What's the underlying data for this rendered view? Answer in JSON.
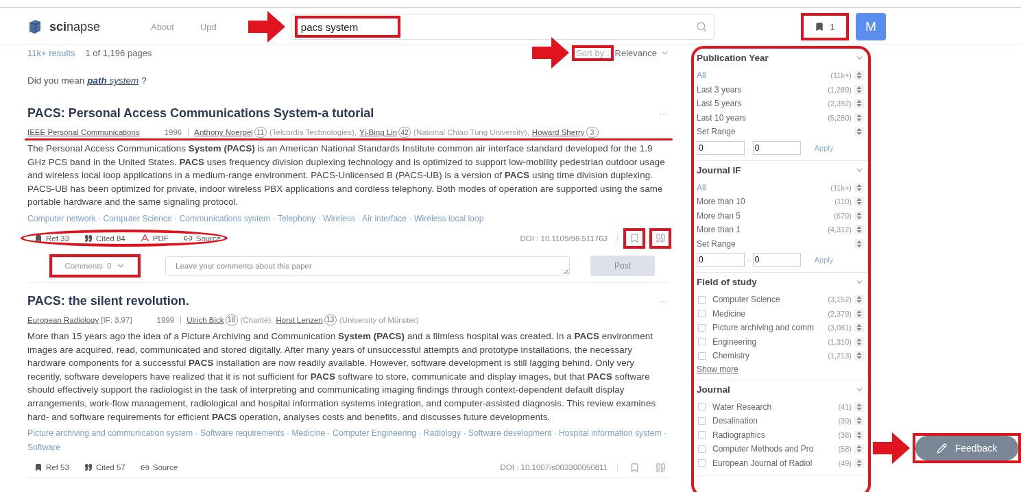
{
  "header": {
    "logo": "**sci**napse",
    "nav": [
      "About",
      "Upd"
    ],
    "search": {
      "value": "pacs system",
      "highlighted": true,
      "arrow": true
    },
    "bookmarks": {
      "count": "1",
      "highlighted": true
    },
    "avatar": "M"
  },
  "results": {
    "count": "11k+ results",
    "pages": "1 of 1,196 pages",
    "sort": {
      "label": "Sort by :",
      "value": "Relevance",
      "highlighted": true,
      "arrow": true
    }
  },
  "suggestion": {
    "prefix": "Did you mean",
    "link": "**path** system",
    "suffix": "?"
  },
  "papers": [
    {
      "title": "PACS: Personal Access Communications System-a tutorial",
      "more": "···",
      "journal": "IEEE Personal Communications",
      "year": "1996",
      "meta_highlighted": true,
      "authors": [
        {
          "name": "Anthony Noerpel",
          "count": "11",
          "affiliation": "(Telcordia Technologies),"
        },
        {
          "name": "Yi-Bing Lin",
          "count": "42",
          "affiliation": "(National Chiao Tung University),"
        },
        {
          "name": "Howard Sherry",
          "count": "3"
        }
      ],
      "abstract": "The Personal Access Communications **System (PACS)** is an American National Standards Institute common air interface standard developed for the 1.9 GHz PCS band in the United States. **PACS** uses frequency division duplexing technology and is optimized to support low-mobility pedestrian outdoor usage and wireless local loop applications in a medium-range environment. PACS-Unlicensed B (PACS-UB) is a version of **PACS** using time division duplexing. PACS-UB has been optimized for private, indoor wireless PBX applications and cordless telephony. Both modes of operation are supported using the same portable hardware and the same signaling protocol.",
      "fields": "Computer network · Computer Science · Communications system · Telephony · Wireless · Air interface · Wireless local loop",
      "actions": [
        {
          "kind": "ref",
          "label": "Ref 33"
        },
        {
          "kind": "cited",
          "label": "Cited 84"
        },
        {
          "kind": "pdf",
          "label": "PDF"
        },
        {
          "kind": "source",
          "label": "Source"
        }
      ],
      "actions_highlighted": true,
      "doi": "DOI : 10.1109/98.511763",
      "save_highlighted": true,
      "cite_highlighted": true,
      "comments": {
        "label": "Comments",
        "count": "0",
        "highlighted": true,
        "placeholder": "Leave your comments about this paper",
        "post": "Post",
        "post_disabled": true
      }
    },
    {
      "title": "PACS: the silent revolution.",
      "more": "···",
      "journal": "European Radiology",
      "journal_if": "[IF: 3.97]",
      "year": "1999",
      "authors": [
        {
          "name": "Ulrich Bick",
          "count": "18",
          "affiliation": "(Charité),"
        },
        {
          "name": "Horst Lenzen",
          "count": "13",
          "affiliation": "(University of Münster)"
        }
      ],
      "abstract": "More than 15 years ago the idea of a Picture Archiving and Communication **System (PACS)** and a filmless hospital was created. In a **PACS** environment images are acquired, read, communicated and stored digitally. After many years of unsuccessful attempts and prototype installations, the necessary hardware components for a successful **PACS** installation are now readily available. However, software development is still lagging behind. Only very recently, software developers have realized that it is not sufficient for **PACS** software to store, communicate and display images, but that **PACS** software should effectively support the radiologist in the task of interpreting and communicating imaging findings through context-dependent default display arrangements, work-flow management, radiological and hospital information systems integration, and computer-assisted diagnosis. This review examines hard- and software requirements for efficient **PACS** operation, analyses costs and benefits, and discusses future developments.",
      "fields": "Picture archiving and communication system · Software requirements · Medicine · Computer Engineering · Radiology · Software development · Hospital information system · Software",
      "actions": [
        {
          "kind": "ref",
          "label": "Ref 53"
        },
        {
          "kind": "cited",
          "label": "Cited 57"
        },
        {
          "kind": "source",
          "label": "Source"
        }
      ],
      "doi": "DOI : 10.1007/s003300050811"
    }
  ],
  "sidebar": {
    "highlighted": true,
    "sections": [
      {
        "title": "Publication Year",
        "options": [
          {
            "kind": "radio",
            "label": "All",
            "count": "(11k+)",
            "selected": true
          },
          {
            "kind": "radio",
            "label": "Last 3 years",
            "count": "(1,289)",
            "selected": false
          },
          {
            "kind": "radio",
            "label": "Last 5 years",
            "count": "(2,392)",
            "selected": false
          },
          {
            "kind": "radio",
            "label": "Last 10 years",
            "count": "(5,280)",
            "selected": false
          },
          {
            "kind": "radio",
            "label": "Set Range",
            "selected": false
          }
        ],
        "range": {
          "from": "0",
          "to": "0",
          "separator": "-",
          "apply": "Apply"
        }
      },
      {
        "title": "Journal IF",
        "options": [
          {
            "kind": "radio",
            "label": "All",
            "count": "(11k+)",
            "selected": true
          },
          {
            "kind": "radio",
            "label": "More than 10",
            "count": "(110)",
            "selected": false
          },
          {
            "kind": "radio",
            "label": "More than 5",
            "count": "(679)",
            "selected": false
          },
          {
            "kind": "radio",
            "label": "More than 1",
            "count": "(4,312)",
            "selected": false
          },
          {
            "kind": "radio",
            "label": "Set Range",
            "selected": false
          }
        ],
        "range": {
          "from": "0",
          "to": "0",
          "separator": "-",
          "apply": "Apply"
        }
      },
      {
        "title": "Field of study",
        "options": [
          {
            "kind": "checkbox",
            "label": "Computer Science",
            "count": "(3,152)",
            "checked": false
          },
          {
            "kind": "checkbox",
            "label": "Medicine",
            "count": "(2,379)",
            "checked": false
          },
          {
            "kind": "checkbox",
            "label": "Picture archiving and comm",
            "count": "(3,081)",
            "checked": false
          },
          {
            "kind": "checkbox",
            "label": "Engineering",
            "count": "(1,310)",
            "checked": false
          },
          {
            "kind": "checkbox",
            "label": "Chemistry",
            "count": "(1,213)",
            "checked": false
          }
        ],
        "show_more": "Show more"
      },
      {
        "title": "Journal",
        "options": [
          {
            "kind": "checkbox",
            "label": "Water Research",
            "count": "(41)",
            "checked": false
          },
          {
            "kind": "checkbox",
            "label": "Desalination",
            "count": "(39)",
            "checked": false
          },
          {
            "kind": "checkbox",
            "label": "Radiographics",
            "count": "(38)",
            "checked": false
          },
          {
            "kind": "checkbox",
            "label": "Computer Methods and Pro",
            "count": "(58)",
            "checked": false
          },
          {
            "kind": "checkbox",
            "label": "European Journal of Radiol",
            "count": "(49)",
            "checked": false
          }
        ]
      }
    ]
  },
  "feedback": {
    "label": "Feedback",
    "highlighted": true,
    "arrow": true
  }
}
